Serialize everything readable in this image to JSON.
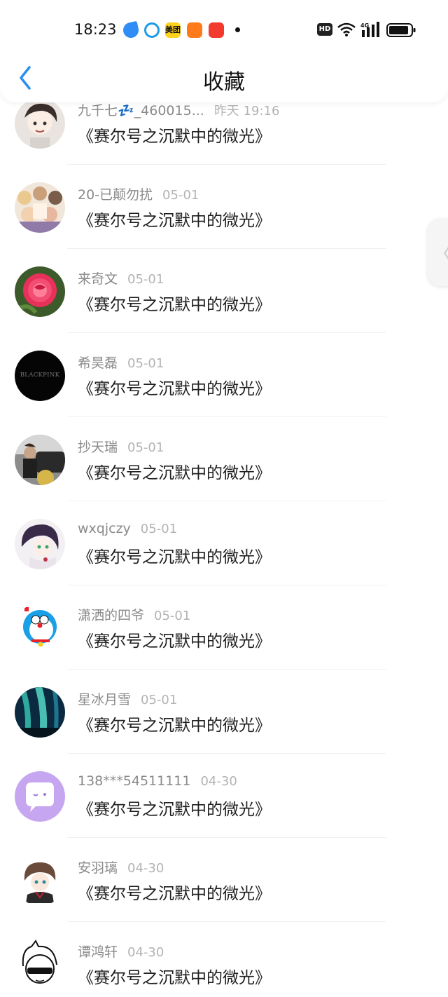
{
  "status_bar": {
    "time": "18:23",
    "hd_label": "HD",
    "network": "4G",
    "app_icons": [
      "blue-bird-icon",
      "blue-face-icon",
      "meituan-icon",
      "orange-app-icon",
      "red-game-icon"
    ]
  },
  "header": {
    "title": "收藏",
    "back_icon": "chevron-left-icon"
  },
  "side_handle": {
    "glyph": "〈"
  },
  "favorites": [
    {
      "user": "九千七💤_460015...",
      "time": "昨天 19:16",
      "title": "《赛尔号之沉默中的微光》"
    },
    {
      "user": "20-已颠勿扰",
      "time": "05-01",
      "title": "《赛尔号之沉默中的微光》"
    },
    {
      "user": "来奇文",
      "time": "05-01",
      "title": "《赛尔号之沉默中的微光》"
    },
    {
      "user": "希昊磊",
      "time": "05-01",
      "title": "《赛尔号之沉默中的微光》",
      "avatar_text": "BLACKPINK"
    },
    {
      "user": "抄天瑞",
      "time": "05-01",
      "title": "《赛尔号之沉默中的微光》"
    },
    {
      "user": "wxqjczy",
      "time": "05-01",
      "title": "《赛尔号之沉默中的微光》"
    },
    {
      "user": "潇洒的四爷",
      "time": "05-01",
      "title": "《赛尔号之沉默中的微光》"
    },
    {
      "user": "星冰月雪",
      "time": "05-01",
      "title": "《赛尔号之沉默中的微光》"
    },
    {
      "user": "138***54511111",
      "time": "04-30",
      "title": "《赛尔号之沉默中的微光》"
    },
    {
      "user": "安羽璃",
      "time": "04-30",
      "title": "《赛尔号之沉默中的微光》"
    },
    {
      "user": "谭鸿轩",
      "time": "04-30",
      "title": "《赛尔号之沉默中的微光》"
    }
  ]
}
